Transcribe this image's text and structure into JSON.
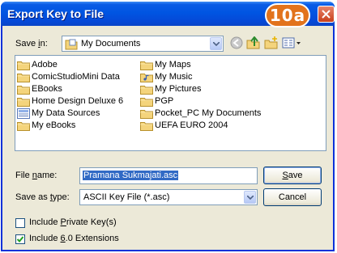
{
  "window": {
    "title": "Export Key to File",
    "badge": "10a"
  },
  "save_in": {
    "label_prefix": "Save ",
    "label_accel": "i",
    "label_suffix": "n:",
    "value": "My Documents",
    "icon": "my-documents-icon"
  },
  "toolbar": {
    "icons": [
      "back-icon",
      "up-folder-icon",
      "new-folder-icon",
      "views-menu-icon"
    ]
  },
  "file_list": {
    "column1": [
      {
        "label": "Adobe",
        "icon": "folder-icon"
      },
      {
        "label": "ComicStudioMini Data",
        "icon": "folder-icon"
      },
      {
        "label": "EBooks",
        "icon": "folder-icon"
      },
      {
        "label": "Home Design Deluxe 6",
        "icon": "folder-icon"
      },
      {
        "label": "My Data Sources",
        "icon": "data-sources-icon"
      },
      {
        "label": "My eBooks",
        "icon": "folder-icon"
      }
    ],
    "column2": [
      {
        "label": "My Maps",
        "icon": "folder-icon"
      },
      {
        "label": "My Music",
        "icon": "music-folder-icon"
      },
      {
        "label": "My Pictures",
        "icon": "folder-icon"
      },
      {
        "label": "PGP",
        "icon": "folder-icon"
      },
      {
        "label": "Pocket_PC My Documents",
        "icon": "folder-icon"
      },
      {
        "label": "UEFA EURO 2004",
        "icon": "folder-icon"
      }
    ]
  },
  "file_name": {
    "label_prefix": "File ",
    "label_accel": "n",
    "label_suffix": "ame:",
    "value": "Pramana Sukmajati.asc"
  },
  "save_as_type": {
    "label_prefix": "Save as ",
    "label_accel": "t",
    "label_suffix": "ype:",
    "value": "ASCII Key File (*.asc)"
  },
  "buttons": {
    "save_accel": "S",
    "save_rest": "ave",
    "cancel": "Cancel"
  },
  "options": {
    "private": {
      "prefix": "Include ",
      "accel": "P",
      "rest": "rivate Key(s)",
      "checked": false
    },
    "ext": {
      "prefix": "Include ",
      "accel": "6",
      "rest": ".0 Extensions",
      "checked": true
    }
  },
  "colors": {
    "titlebar": "#0055e2",
    "badge": "#e2731c",
    "selection": "#316ac5",
    "folder": "#f4d47c"
  }
}
